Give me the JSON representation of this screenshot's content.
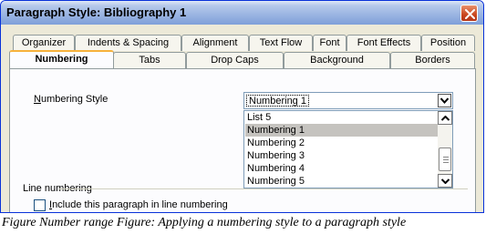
{
  "window": {
    "title": "Paragraph Style: Bibliography 1"
  },
  "tabs_row1": [
    {
      "label": "Organizer"
    },
    {
      "label": "Indents & Spacing"
    },
    {
      "label": "Alignment"
    },
    {
      "label": "Text Flow"
    },
    {
      "label": "Font"
    },
    {
      "label": "Font Effects"
    },
    {
      "label": "Position"
    }
  ],
  "tabs_row2": [
    {
      "label": "Numbering",
      "active": true
    },
    {
      "label": "Tabs"
    },
    {
      "label": "Drop Caps"
    },
    {
      "label": "Background"
    },
    {
      "label": "Borders"
    }
  ],
  "numbering": {
    "label_prefix": "N",
    "label_rest": "umbering Style",
    "selected": "Numbering 1",
    "options": [
      "List 5",
      "Numbering 1",
      "Numbering 2",
      "Numbering 3",
      "Numbering 4",
      "Numbering 5"
    ],
    "highlighted_index": 1
  },
  "line_numbering": {
    "group_label": "Line numbering",
    "checkbox_prefix": "I",
    "checkbox_rest": "nclude this paragraph in line numbering",
    "checked": false
  },
  "caption": "Figure Number range Figure: Applying a numbering style to a paragraph style",
  "icons": {
    "close": "close-icon",
    "dropdown": "chevron-down-icon",
    "scroll_up": "arrow-up-icon",
    "scroll_down": "arrow-down-icon"
  },
  "colors": {
    "dialog_bg": "#ece9d8",
    "active_tab_accent": "#f7b23b",
    "close_button": "#c9461e"
  }
}
